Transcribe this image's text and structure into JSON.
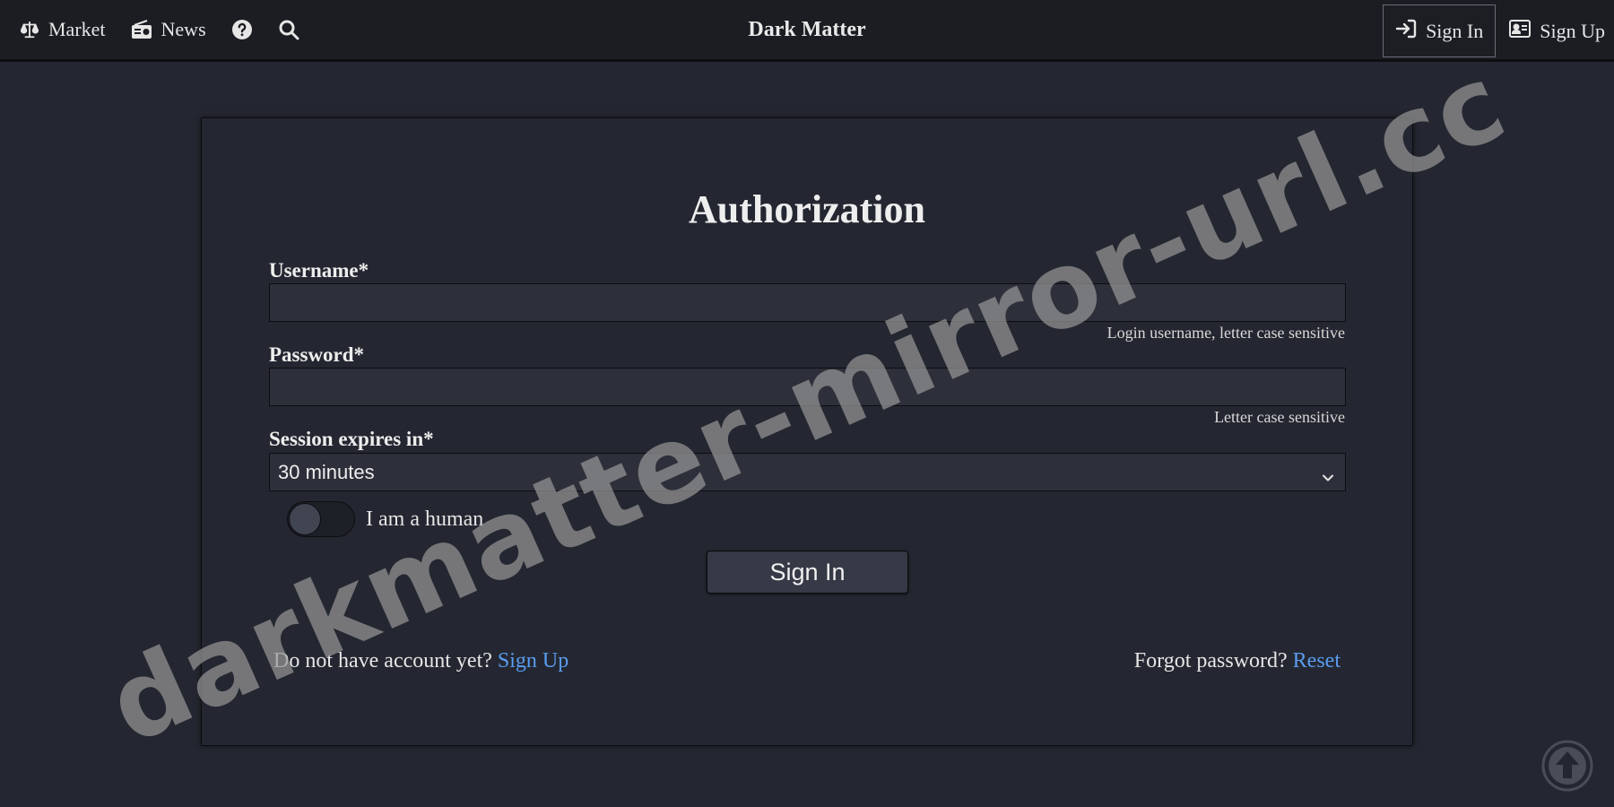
{
  "nav": {
    "brand": "Dark Matter",
    "left_items": [
      {
        "label": "Market",
        "icon": "scale-icon"
      },
      {
        "label": "News",
        "icon": "radio-icon"
      },
      {
        "label": "",
        "icon": "question-icon"
      },
      {
        "label": "",
        "icon": "search-icon"
      }
    ],
    "sign_in": "Sign In",
    "sign_up": "Sign Up"
  },
  "form": {
    "title": "Authorization",
    "username": {
      "label": "Username*",
      "value": "",
      "hint": "Login username, letter case sensitive"
    },
    "password": {
      "label": "Password*",
      "value": "",
      "hint": "Letter case sensitive"
    },
    "session": {
      "label": "Session expires in*",
      "selected": "30 minutes"
    },
    "human_toggle": {
      "label": "I am a human",
      "checked": false
    },
    "submit": "Sign In",
    "no_account_text": "Do not have account yet?",
    "signup_link": "Sign Up",
    "forgot_text": "Forgot password?",
    "reset_link": "Reset"
  },
  "watermark": "darkmatter-mirror-url.cc",
  "colors": {
    "background": "#242731",
    "topbar": "#1b1d22",
    "link": "#5a9cf0",
    "input_bg": "#2d303a"
  }
}
